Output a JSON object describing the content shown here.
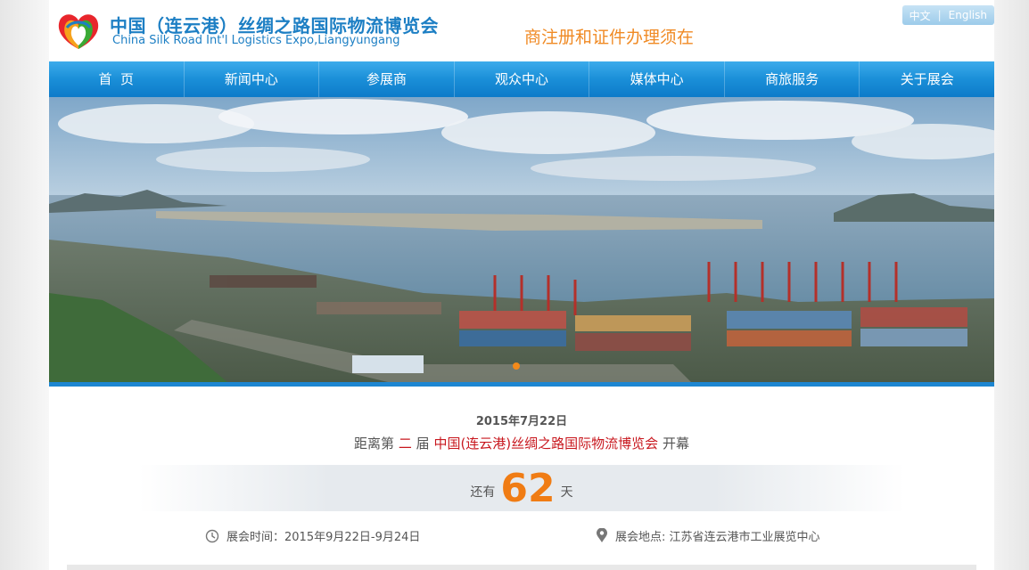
{
  "header": {
    "logo_cn": "中国（连云港）丝绸之路国际物流博览会",
    "logo_en": "China Silk Road Int'l Logistics Expo,Liangyungang",
    "ticker": "商注册和证件办理须在",
    "lang": {
      "cn": "中文",
      "sep": "|",
      "en": "English"
    }
  },
  "nav": [
    "首  页",
    "新闻中心",
    "参展商",
    "观众中心",
    "媒体中心",
    "商旅服务",
    "关于展会"
  ],
  "countdown": {
    "date": "2015年7月22日",
    "prefix": "距离第",
    "edition": "二",
    "edition_suffix": "届",
    "expo_name": "中国(连云港)丝绸之路国际物流博览会",
    "suffix": "开幕",
    "remaining_prefix": "还有",
    "days": "62",
    "days_unit": "天"
  },
  "info": {
    "time": "展会时间：2015年9月22日-9月24日",
    "place": "展会地点: 江苏省连云港市工业展览中心"
  },
  "icons": [
    "logo-icon",
    "clock-icon",
    "location-pin-icon"
  ],
  "colors": {
    "brand": "#1d7fc4",
    "accent": "#f07c14",
    "highlight": "#c8171e",
    "nav": "#1a8fd8"
  }
}
